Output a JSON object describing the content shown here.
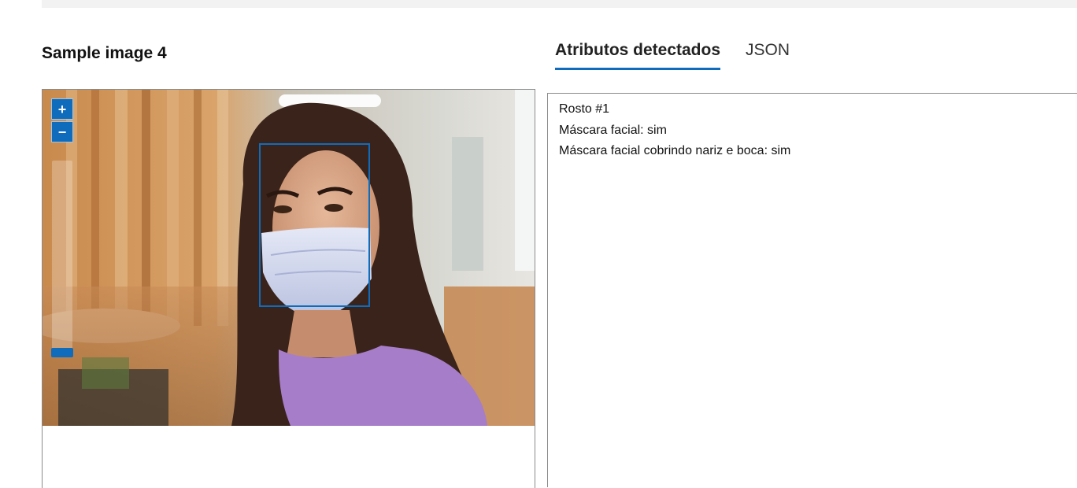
{
  "section_title": "Sample image 4",
  "viewer": {
    "zoom_in_label": "+",
    "zoom_out_label": "−",
    "zoom_level": 0
  },
  "tabs": [
    {
      "label": "Atributos detectados",
      "active": true
    },
    {
      "label": "JSON",
      "active": false
    }
  ],
  "results": {
    "face_label": "Rosto #1",
    "mask_line": "Máscara facial: sim",
    "mask_cover_line": "Máscara facial cobrindo nariz e boca: sim"
  },
  "colors": {
    "accent": "#0f6cbd",
    "top_strip": "#f2f2f2",
    "border": "#8a8a8a"
  }
}
